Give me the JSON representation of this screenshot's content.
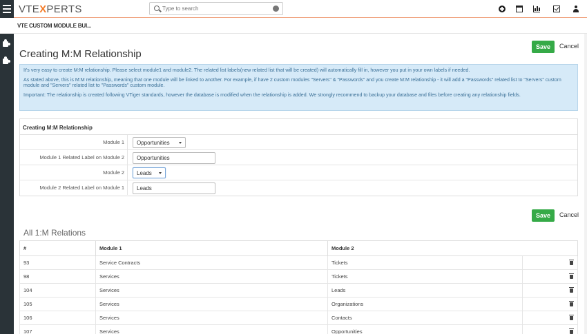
{
  "header": {
    "logo_prefix": "VTE",
    "logo_x": "X",
    "logo_suffix": "PERTS",
    "search_placeholder": "Type to search"
  },
  "breadcrumb": "VTE CUSTOM MODULE BUI...",
  "page": {
    "title": "Creating M:M Relationship",
    "save_label": "Save",
    "cancel_label": "Cancel"
  },
  "info": {
    "p1": "It's very easy to create M:M relationship. Please select module1 and module2. The related list labels(new related list that will be created) will automatically fill in, however you put in your own labels if needed.",
    "p2": "As stated above, this is M:M relationship, meaning that one module will be linked to another. For example, if have 2 custom modules \"Servers\" & \"Passwords\" and you create M:M relationship - it will add a \"Passwords\" related list to \"Servers\" custom module and \"Servers\" related list to \"Passwords\" custom module.",
    "p3": "Important: The relationship is created following VTiger standards, however the database is modified when the relationship is added. We strongly recommend to backup your database and files before creating any relationship fields."
  },
  "form": {
    "heading": "Creating M:M Relationship",
    "module1_label": "Module 1",
    "module1_value": "Opportunities",
    "module1_related_label": "Module 1 Related Label on Module 2",
    "module1_related_value": "Opportunities",
    "module2_label": "Module 2",
    "module2_value": "Leads",
    "module2_related_label": "Module 2 Related Label on Module 1",
    "module2_related_value": "Leads"
  },
  "relations": {
    "title": "All 1:M Relations",
    "columns": [
      "#",
      "Module 1",
      "Module 2"
    ],
    "rows": [
      [
        "93",
        "Service Contracts",
        "Tickets"
      ],
      [
        "98",
        "Services",
        "Tickets"
      ],
      [
        "104",
        "Services",
        "Leads"
      ],
      [
        "105",
        "Services",
        "Organizations"
      ],
      [
        "106",
        "Services",
        "Contacts"
      ],
      [
        "107",
        "Services",
        "Opportunities"
      ]
    ]
  },
  "colors": {
    "save_green": "#35aa47",
    "info_bg": "#d6eaf8",
    "nav_dark": "#2a3338",
    "logo_accent": "#f47a26"
  }
}
